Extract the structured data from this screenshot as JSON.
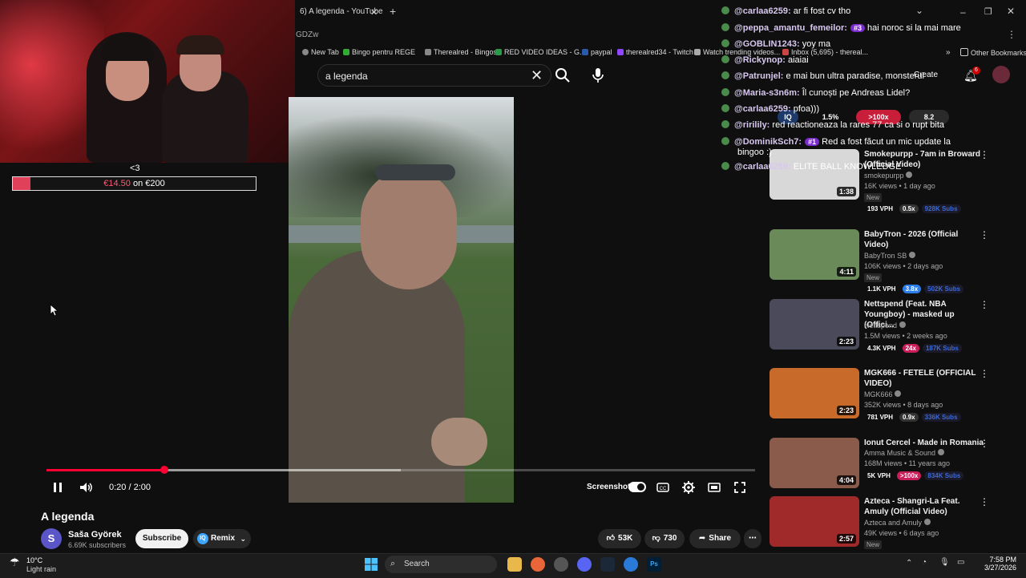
{
  "browser": {
    "tab_title": "6) A legenda - YouTube",
    "url_fragment": "GDZw",
    "bookmarks": [
      "New Tab",
      "Bingo pentru REGE",
      "Therealred - Bingos",
      "RED VIDEO IDEAS - G...",
      "paypal",
      "therealred34 - Twitch",
      "Watch trending videos...",
      "Inbox (5,695) - thereal..."
    ],
    "other_bookmarks": "Other Bookmarks"
  },
  "search": {
    "value": "a legenda"
  },
  "stream": {
    "heart_text": "<3",
    "goal_current": "€14.50",
    "goal_rest": " on €200",
    "goal_progress": 0.0725
  },
  "player": {
    "time": "0:20 / 2:00",
    "progress": 0.1667,
    "buffer": 0.5,
    "screenshot_label": "Screenshot"
  },
  "video": {
    "title": "A legenda",
    "channel": "Saša Györek",
    "avatar_letter": "S",
    "subscribers": "6.69K subscribers",
    "subscribe_label": "Subscribe",
    "remix_label": "Remix",
    "likes": "53K",
    "dislikes": "730",
    "share_label": "Share"
  },
  "chat": [
    {
      "user": "@carlaa6259:",
      "msg": " ar fi fost cv tho",
      "badge": ""
    },
    {
      "user": "@peppa_amantu_femeilor:",
      "msg": " hai noroc si la mai mare",
      "badge": "#3"
    },
    {
      "user": "@GOBLIN1243:",
      "msg": " yoy ma",
      "badge": ""
    },
    {
      "user": "@Rickynop:",
      "msg": " aiaiai",
      "badge": ""
    },
    {
      "user": "@Patrunjel:",
      "msg": " e mai bun ultra paradise, monsterul",
      "badge": ""
    },
    {
      "user": "@Maria-s3n6m:",
      "msg": " Îl cunoști pe Andreas Lidel?",
      "badge": ""
    },
    {
      "user": "@carlaa6259:",
      "msg": " pfoa)))",
      "badge": ""
    },
    {
      "user": "@ririlily:",
      "msg": " red reactioneaza la rares 77 ca si o rupt bita",
      "badge": ""
    },
    {
      "user": "@DominikSch7:",
      "msg": " Red a fost făcut un mic update la",
      "badge": "#1"
    },
    {
      "user": "",
      "msg": "bingoo :)",
      "badge": ""
    },
    {
      "user": "@carlaa6259:",
      "msg": " ELITE BALL KNOWLEDGE",
      "badge": ""
    }
  ],
  "overlay_stats": [
    "1.5%",
    ">100x",
    "8.2"
  ],
  "create_label": "Create",
  "notif_count": "6",
  "recommended": [
    {
      "title": "Smokepurpp - 7am in Broward (Official Video)",
      "channel": "smokepurpp",
      "meta": "16K views • 1 day ago",
      "new": "New",
      "duration": "1:38",
      "vph": "193 VPH",
      "mult": "0.5x",
      "subs": "928K Subs",
      "mult_color": "#333333",
      "thumb_color": "#d8d8d8"
    },
    {
      "title": "BabyTron - 2026 (Official Video)",
      "channel": "BabyTron SB",
      "meta": "106K views • 2 days ago",
      "new": "New",
      "duration": "4:11",
      "vph": "1.1K VPH",
      "mult": "3.8x",
      "subs": "502K Subs",
      "mult_color": "#2b7de9",
      "thumb_color": "#6a8a5a"
    },
    {
      "title": "Nettspend (Feat. NBA Youngboy) - masked up (Offici...",
      "channel": "Nettspend",
      "meta": "1.5M views • 2 weeks ago",
      "new": "",
      "duration": "2:23",
      "vph": "4.3K VPH",
      "mult": "24x",
      "subs": "187K Subs",
      "mult_color": "#c81e5a",
      "thumb_color": "#4a4a5a"
    },
    {
      "title": "MGK666 - FETELE (OFFICIAL VIDEO)",
      "channel": "MGK666",
      "meta": "352K views • 8 days ago",
      "new": "",
      "duration": "2:23",
      "vph": "781 VPH",
      "mult": "0.9x",
      "subs": "336K Subs",
      "mult_color": "#333333",
      "thumb_color": "#c86a2a"
    },
    {
      "title": "Ionut Cercel - Made in Romania",
      "channel": "Amma Music & Sound",
      "meta": "168M views • 11 years ago",
      "new": "",
      "duration": "4:04",
      "vph": "5K VPH",
      "mult": ">100x",
      "subs": "834K Subs",
      "mult_color": "#c81e5a",
      "thumb_color": "#8a5a4a"
    },
    {
      "title": "Azteca - Shangri-La Feat. Amuly (Official Video)",
      "channel": "Azteca and Amuly",
      "meta": "49K views • 6 days ago",
      "new": "New",
      "duration": "2:57",
      "vph": "",
      "mult": "",
      "subs": "",
      "mult_color": "#333333",
      "thumb_color": "#a02a2a"
    }
  ],
  "taskbar": {
    "temp": "10°C",
    "weather": "Light rain",
    "search_label": "Search",
    "time": "7:58 PM",
    "date": "3/27/2026"
  }
}
